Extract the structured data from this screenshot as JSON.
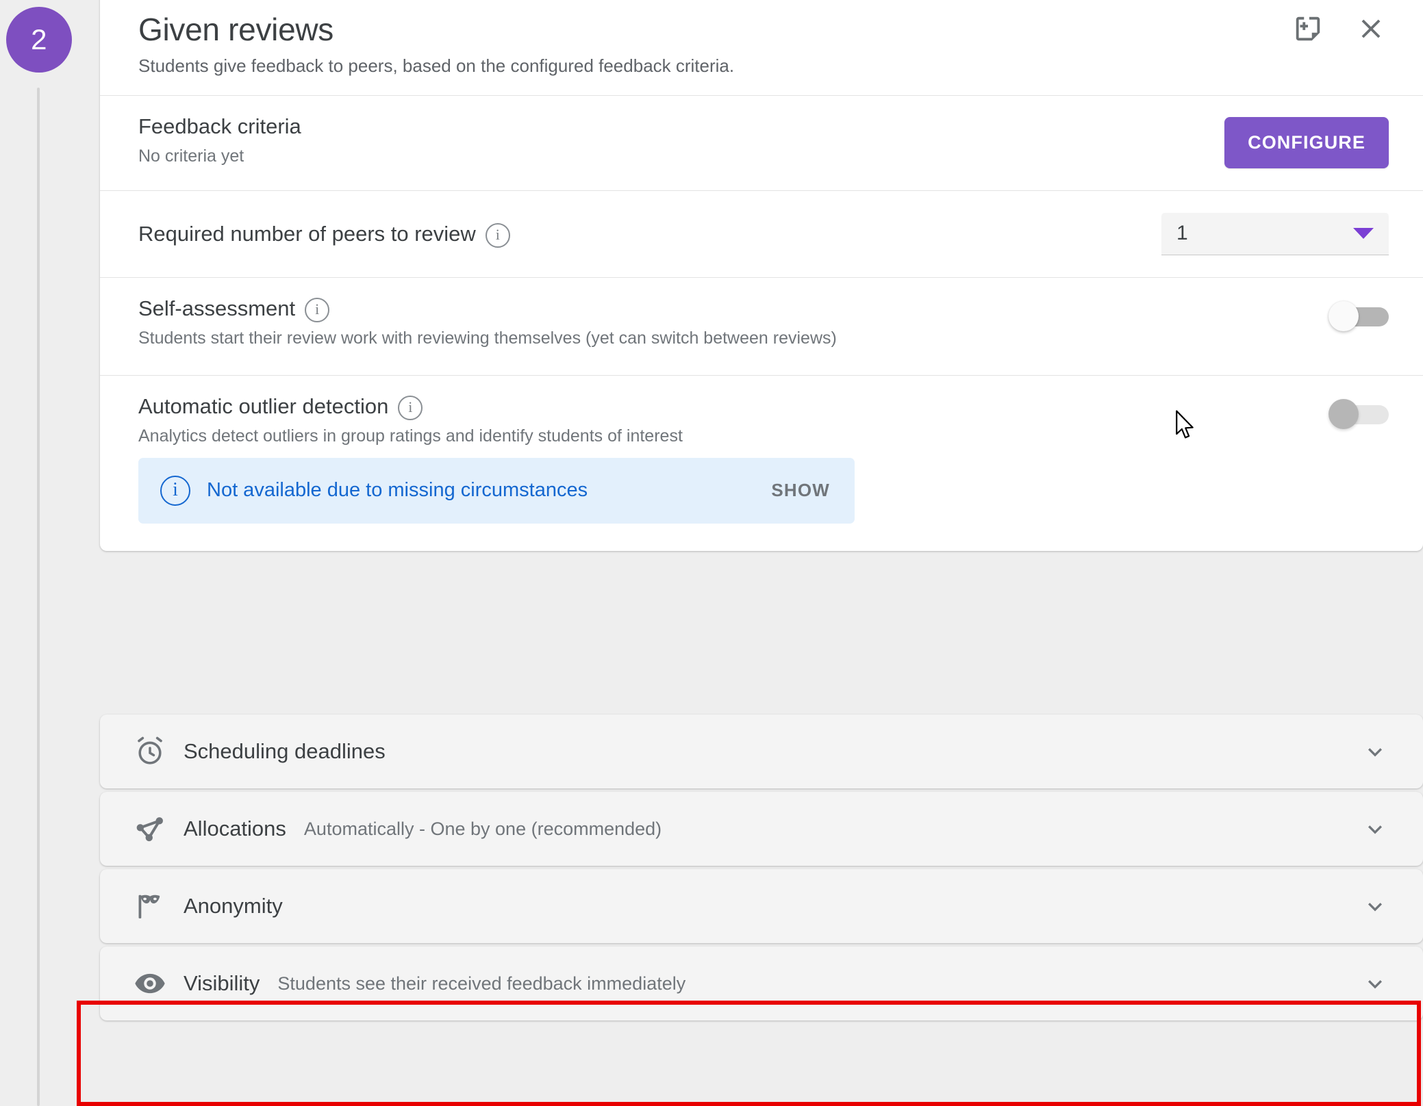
{
  "stepper": {
    "step_number": "2"
  },
  "header": {
    "title": "Given reviews",
    "subtitle": "Students give feedback to peers, based on the configured feedback criteria.",
    "actions": [
      {
        "name": "add-note-icon",
        "label": "Add note"
      },
      {
        "name": "close-icon",
        "label": "Close"
      }
    ]
  },
  "rows": {
    "feedback_criteria": {
      "title": "Feedback criteria",
      "subtitle": "No criteria yet",
      "button_label": "CONFIGURE"
    },
    "peers_to_review": {
      "title": "Required number of peers to review",
      "value": "1",
      "has_info": true
    },
    "self_assessment": {
      "title": "Self-assessment",
      "subtitle": "Students start their review work with reviewing themselves (yet can switch between reviews)",
      "toggle_state": "off",
      "has_info": true
    },
    "outlier_detection": {
      "title": "Automatic outlier detection",
      "subtitle": "Analytics detect outliers in group ratings and identify students of interest",
      "toggle_state": "disabled",
      "has_info": true,
      "banner": {
        "icon": "info-icon",
        "text": "Not available due to missing circumstances",
        "action_label": "SHOW"
      }
    }
  },
  "panels": [
    {
      "icon": "alarm-clock-icon",
      "title": "Scheduling deadlines",
      "value": "",
      "expanded": false
    },
    {
      "icon": "share-nodes-icon",
      "title": "Allocations",
      "value": "Automatically - One by one (recommended)",
      "expanded": false
    },
    {
      "icon": "mask-icon",
      "title": "Anonymity",
      "value": "",
      "expanded": false
    },
    {
      "icon": "eye-icon",
      "title": "Visibility",
      "value": "Students see their received feedback immediately",
      "expanded": false
    }
  ],
  "highlight": {
    "target": "Visibility",
    "color": "#e80000"
  },
  "colors": {
    "accent_purple": "#7e57c8",
    "step_badge": "#7e4fc0",
    "banner_bg": "#e3f0fc",
    "banner_text": "#1467d0",
    "panel_bg": "#f4f4f4",
    "page_bg": "#eeeeee"
  }
}
